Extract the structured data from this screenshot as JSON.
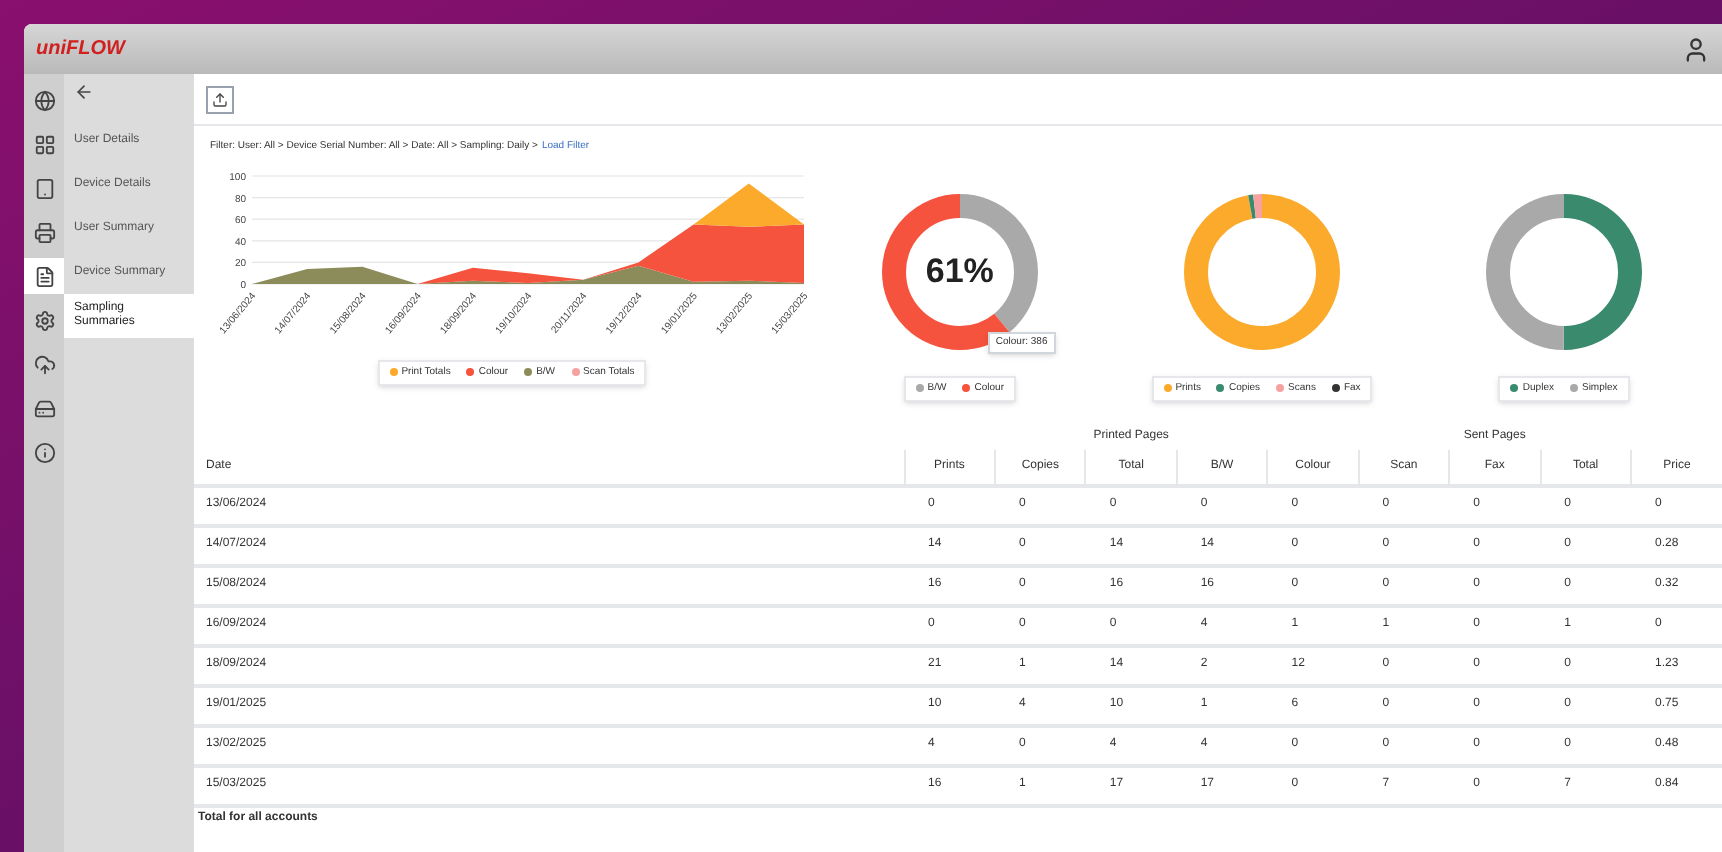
{
  "header": {
    "logo": "uniFLOW"
  },
  "nav_icons": [
    {
      "kind": "globe",
      "selected": false
    },
    {
      "kind": "grid",
      "selected": false
    },
    {
      "kind": "tablet",
      "selected": false
    },
    {
      "kind": "printer",
      "selected": false
    },
    {
      "kind": "report",
      "selected": true
    },
    {
      "kind": "settings",
      "selected": false
    },
    {
      "kind": "cloud",
      "selected": false
    },
    {
      "kind": "drive",
      "selected": false
    },
    {
      "kind": "info",
      "selected": false
    }
  ],
  "sidebar": {
    "items": [
      {
        "label": "User Details",
        "selected": false
      },
      {
        "label": "Device Details",
        "selected": false
      },
      {
        "label": "User Summary",
        "selected": false
      },
      {
        "label": "Device Summary",
        "selected": false
      },
      {
        "label": "Sampling Summaries",
        "selected": true
      }
    ]
  },
  "breadcrumb": {
    "text": "Filter: User: All > Device Serial Number: All > Date: All > Sampling: Daily >",
    "link": "Load Filter"
  },
  "area_chart": {
    "chart_data": {
      "type": "area",
      "stacked": true,
      "grid": true,
      "categories": [
        "13/06/2024",
        "14/07/2024",
        "15/08/2024",
        "16/09/2024",
        "18/09/2024",
        "19/10/2024",
        "20/11/2024",
        "19/12/2024",
        "19/01/2025",
        "13/02/2025",
        "15/03/2025"
      ],
      "ylim": [
        0,
        100
      ],
      "yticks": [
        0,
        20,
        40,
        60,
        80,
        100
      ],
      "series": [
        {
          "name": "B/W",
          "color": "#8c8c5a",
          "values": [
            0,
            14,
            16,
            0,
            3,
            1,
            4,
            17,
            2,
            3,
            1
          ]
        },
        {
          "name": "Colour",
          "color": "#f5533d",
          "values": [
            0,
            0,
            0,
            0,
            12,
            9,
            0,
            3,
            53,
            50,
            54
          ]
        },
        {
          "name": "Print Totals",
          "color": "#fbaa2c",
          "values": [
            0,
            0,
            0,
            0,
            0,
            0,
            0,
            0,
            0,
            40,
            0
          ]
        }
      ]
    },
    "legend_extra": [
      {
        "label": "Scan Totals",
        "color": "#f7a1a1"
      }
    ]
  },
  "donuts": [
    {
      "center": "61%",
      "tooltip": "Colour: 386",
      "legend": [
        {
          "label": "B/W",
          "color": "#a9a9a9"
        },
        {
          "label": "Colour",
          "color": "#f5533d"
        }
      ]
    },
    {
      "legend": [
        {
          "label": "Prints",
          "color": "#fbaa2c"
        },
        {
          "label": "Copies",
          "color": "#3a8a6e"
        },
        {
          "label": "Scans",
          "color": "#f7a1a1"
        },
        {
          "label": "Fax",
          "color": "#333333"
        }
      ]
    },
    {
      "legend": [
        {
          "label": "Duplex",
          "color": "#3a8a6e"
        },
        {
          "label": "Simplex",
          "color": "#a9a9a9"
        }
      ]
    }
  ],
  "table": {
    "groups": [
      "Printed Pages",
      "Sent Pages"
    ],
    "columns": [
      "Date",
      "Prints",
      "Copies",
      "Total",
      "B/W",
      "Colour",
      "Scan",
      "Fax",
      "Total",
      "Price"
    ],
    "rows": [
      [
        "13/06/2024",
        "0",
        "0",
        "0",
        "0",
        "0",
        "0",
        "0",
        "0",
        "0"
      ],
      [
        "14/07/2024",
        "14",
        "0",
        "14",
        "14",
        "0",
        "0",
        "0",
        "0",
        "0.28"
      ],
      [
        "15/08/2024",
        "16",
        "0",
        "16",
        "16",
        "0",
        "0",
        "0",
        "0",
        "0.32"
      ],
      [
        "16/09/2024",
        "0",
        "0",
        "0",
        "4",
        "1",
        "1",
        "0",
        "1",
        "0"
      ],
      [
        "18/09/2024",
        "21",
        "1",
        "14",
        "2",
        "12",
        "0",
        "0",
        "0",
        "1.23"
      ],
      [
        "19/01/2025",
        "10",
        "4",
        "10",
        "1",
        "6",
        "0",
        "0",
        "0",
        "0.75"
      ],
      [
        "13/02/2025",
        "4",
        "0",
        "4",
        "4",
        "0",
        "0",
        "0",
        "0",
        "0.48"
      ],
      [
        "15/03/2025",
        "16",
        "1",
        "17",
        "17",
        "0",
        "7",
        "0",
        "7",
        "0.84"
      ]
    ],
    "footer": "Total for all accounts"
  }
}
